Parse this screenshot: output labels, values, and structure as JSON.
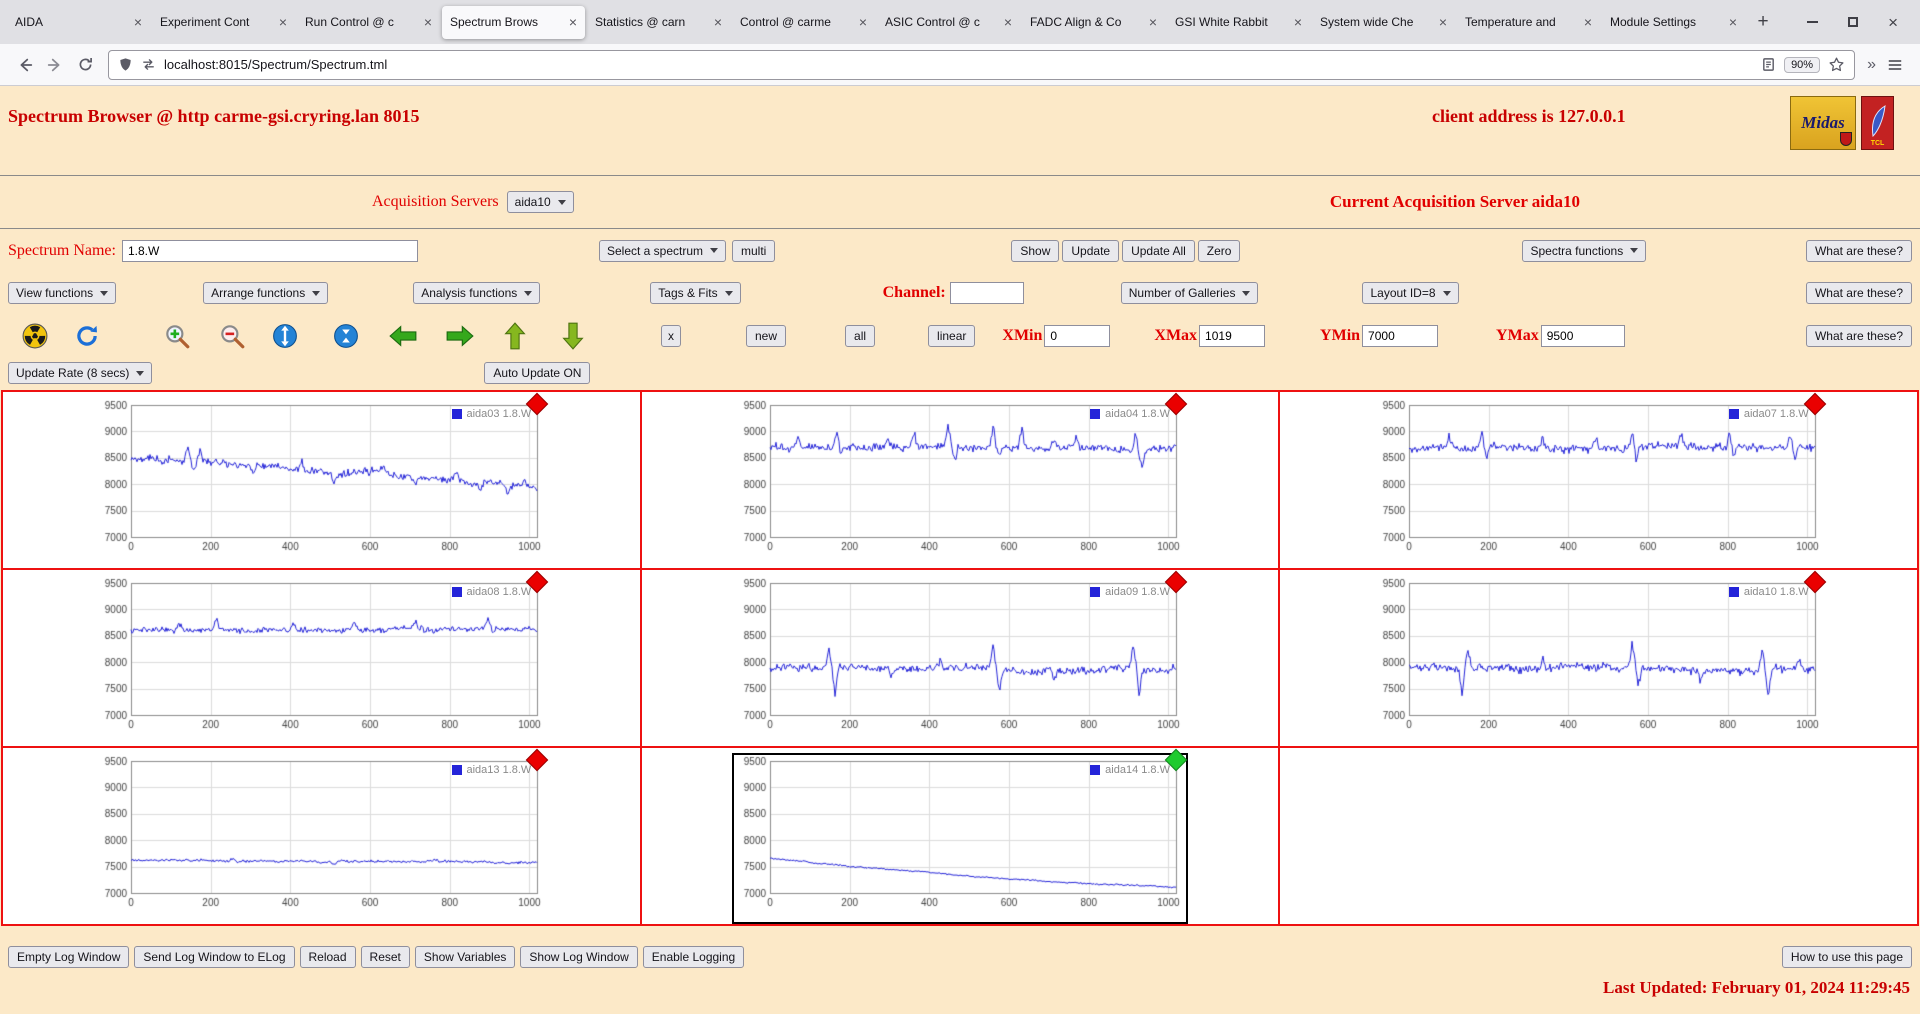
{
  "browser": {
    "tabs": [
      "AIDA",
      "Experiment Cont",
      "Run Control @ c",
      "Spectrum Brows",
      "Statistics @ carn",
      "Control @ carme",
      "ASIC Control @ c",
      "FADC Align & Co",
      "GSI White Rabbit",
      "System wide Che",
      "Temperature and",
      "Module Settings"
    ],
    "active_tab_index": 3,
    "tab_close_glyph": "×",
    "new_tab_label": "+",
    "close_glyph": "×",
    "overflow_glyph": "»",
    "url": "localhost:8015/Spectrum/Spectrum.tml",
    "zoom_level": "90%"
  },
  "header": {
    "title": "Spectrum Browser @ http carme-gsi.cryring.lan 8015",
    "client": "client address is 127.0.0.1",
    "midas_logo_text": "Midas",
    "tcl_logo_text": "TCL"
  },
  "acquisition": {
    "label": "Acquisition Servers",
    "selected": "aida10",
    "current": "Current Acquisition Server aida10"
  },
  "controls": {
    "spectrum_name_label": "Spectrum Name:",
    "spectrum_name_value": "1.8.W",
    "select_spectrum": "Select a spectrum",
    "multi": "multi",
    "show": "Show",
    "update": "Update",
    "update_all": "Update All",
    "zero": "Zero",
    "spectra_functions": "Spectra functions",
    "what_are_these": "What are these?",
    "view_functions": "View functions",
    "arrange_functions": "Arrange functions",
    "analysis_functions": "Analysis functions",
    "tags_fits": "Tags & Fits",
    "channel_label": "Channel:",
    "channel_value": "",
    "number_of_galleries": "Number of Galleries",
    "layout_id": "Layout ID=8",
    "x_button": "x",
    "new_button": "new",
    "all_button": "all",
    "linear_button": "linear",
    "xmin_label": "XMin",
    "xmin": "0",
    "xmax_label": "XMax",
    "xmax": "1019",
    "ymin_label": "YMin",
    "ymin": "7000",
    "ymax_label": "YMax",
    "ymax": "9500",
    "update_rate": "Update Rate (8 secs)",
    "auto_update": "Auto Update ON"
  },
  "icons": {
    "radiation-icon": "black trefoil on yellow disc",
    "update-refresh-icon": "blue circular arrow",
    "zoom-in-icon": "magnifier with green plus",
    "zoom-out-icon": "magnifier with red minus",
    "y-expand-icon": "blue disc, white vertical arrows outward",
    "y-compress-icon": "blue disc, white vertical arrows inward",
    "pan-left-icon": "green block arrow left",
    "pan-right-icon": "green block arrow right",
    "pan-up-icon": "green block arrow up",
    "pan-down-icon": "green block arrow down"
  },
  "chart_data": [
    {
      "type": "line",
      "title": "aida03 1.8.W",
      "xlabel": "",
      "ylabel": "",
      "xlim": [
        0,
        1019
      ],
      "ylim": [
        7000,
        9500
      ],
      "xticks": [
        0,
        200,
        400,
        600,
        800,
        1000
      ],
      "yticks": [
        7000,
        7500,
        8000,
        8500,
        9000,
        9500
      ],
      "grid": true,
      "legend_position": "top-right",
      "line_color": "#2424d9",
      "marker": "red-diamond",
      "marker_color": "#ea0000",
      "selected": false,
      "seed": 3,
      "baseline_start": 8480,
      "baseline_end": 7920,
      "curve": 50,
      "noise": 110,
      "spikes": [
        [
          0.14,
          300
        ],
        [
          0.155,
          -220
        ],
        [
          0.17,
          260
        ],
        [
          0.3,
          -170
        ],
        [
          0.42,
          190
        ],
        [
          0.5,
          -160
        ],
        [
          0.62,
          170
        ],
        [
          0.7,
          -150
        ],
        [
          0.8,
          170
        ],
        [
          0.86,
          -210
        ],
        [
          0.93,
          -190
        ],
        [
          0.97,
          140
        ]
      ]
    },
    {
      "type": "line",
      "title": "aida04 1.8.W",
      "xlabel": "",
      "ylabel": "",
      "xlim": [
        0,
        1019
      ],
      "ylim": [
        7000,
        9500
      ],
      "xticks": [
        0,
        200,
        400,
        600,
        800,
        1000
      ],
      "yticks": [
        7000,
        7500,
        8000,
        8500,
        9000,
        9500
      ],
      "grid": true,
      "legend_position": "top-right",
      "line_color": "#2424d9",
      "marker": "red-diamond",
      "marker_color": "#ea0000",
      "selected": false,
      "seed": 4,
      "baseline_start": 8700,
      "baseline_end": 8680,
      "curve": 0,
      "noise": 115,
      "spikes": [
        [
          0.07,
          240
        ],
        [
          0.165,
          340
        ],
        [
          0.175,
          -210
        ],
        [
          0.29,
          210
        ],
        [
          0.355,
          290
        ],
        [
          0.44,
          430
        ],
        [
          0.455,
          -280
        ],
        [
          0.55,
          470
        ],
        [
          0.565,
          -230
        ],
        [
          0.62,
          410
        ],
        [
          0.7,
          230
        ],
        [
          0.755,
          270
        ],
        [
          0.9,
          450
        ],
        [
          0.915,
          -370
        ]
      ]
    },
    {
      "type": "line",
      "title": "aida07 1.8.W",
      "xlabel": "",
      "ylabel": "",
      "xlim": [
        0,
        1019
      ],
      "ylim": [
        7000,
        9500
      ],
      "xticks": [
        0,
        200,
        400,
        600,
        800,
        1000
      ],
      "yticks": [
        7000,
        7500,
        8000,
        8500,
        9000,
        9500
      ],
      "grid": true,
      "legend_position": "top-right",
      "line_color": "#2424d9",
      "marker": "red-diamond",
      "marker_color": "#ea0000",
      "selected": false,
      "seed": 7,
      "baseline_start": 8680,
      "baseline_end": 8700,
      "curve": 0,
      "noise": 115,
      "spikes": [
        [
          0.1,
          250
        ],
        [
          0.18,
          350
        ],
        [
          0.19,
          -250
        ],
        [
          0.33,
          230
        ],
        [
          0.46,
          290
        ],
        [
          0.55,
          340
        ],
        [
          0.56,
          -210
        ],
        [
          0.67,
          270
        ],
        [
          0.79,
          330
        ],
        [
          0.8,
          -230
        ],
        [
          0.94,
          370
        ],
        [
          0.95,
          -250
        ]
      ]
    },
    {
      "type": "line",
      "title": "aida08 1.8.W",
      "xlabel": "",
      "ylabel": "",
      "xlim": [
        0,
        1019
      ],
      "ylim": [
        7000,
        9500
      ],
      "xticks": [
        0,
        200,
        400,
        600,
        800,
        1000
      ],
      "yticks": [
        7000,
        7500,
        8000,
        8500,
        9000,
        9500
      ],
      "grid": true,
      "legend_position": "top-right",
      "line_color": "#2424d9",
      "marker": "red-diamond",
      "marker_color": "#ea0000",
      "selected": false,
      "seed": 8,
      "baseline_start": 8600,
      "baseline_end": 8620,
      "curve": 0,
      "noise": 85,
      "spikes": [
        [
          0.12,
          170
        ],
        [
          0.21,
          230
        ],
        [
          0.4,
          160
        ],
        [
          0.55,
          190
        ],
        [
          0.7,
          170
        ],
        [
          0.88,
          210
        ],
        [
          0.89,
          -150
        ]
      ]
    },
    {
      "type": "line",
      "title": "aida09 1.8.W",
      "xlabel": "",
      "ylabel": "",
      "xlim": [
        0,
        1019
      ],
      "ylim": [
        7000,
        9500
      ],
      "xticks": [
        0,
        200,
        400,
        600,
        800,
        1000
      ],
      "yticks": [
        7000,
        7500,
        8000,
        8500,
        9000,
        9500
      ],
      "grid": true,
      "legend_position": "top-right",
      "line_color": "#2424d9",
      "marker": "red-diamond",
      "marker_color": "#ea0000",
      "selected": false,
      "seed": 9,
      "baseline_start": 7890,
      "baseline_end": 7880,
      "curve": 0,
      "noise": 120,
      "spikes": [
        [
          0.145,
          430
        ],
        [
          0.16,
          -530
        ],
        [
          0.3,
          -190
        ],
        [
          0.42,
          210
        ],
        [
          0.55,
          490
        ],
        [
          0.565,
          -430
        ],
        [
          0.7,
          -210
        ],
        [
          0.895,
          530
        ],
        [
          0.91,
          -490
        ]
      ]
    },
    {
      "type": "line",
      "title": "aida10 1.8.W",
      "xlabel": "",
      "ylabel": "",
      "xlim": [
        0,
        1019
      ],
      "ylim": [
        7000,
        9500
      ],
      "xticks": [
        0,
        200,
        400,
        600,
        800,
        1000
      ],
      "yticks": [
        7000,
        7500,
        8000,
        8500,
        9000,
        9500
      ],
      "grid": true,
      "legend_position": "top-right",
      "line_color": "#2424d9",
      "marker": "red-diamond",
      "marker_color": "#ea0000",
      "selected": false,
      "seed": 10,
      "baseline_start": 7900,
      "baseline_end": 7890,
      "curve": 0,
      "noise": 120,
      "spikes": [
        [
          0.13,
          -470
        ],
        [
          0.145,
          390
        ],
        [
          0.33,
          230
        ],
        [
          0.55,
          510
        ],
        [
          0.565,
          -390
        ],
        [
          0.72,
          -230
        ],
        [
          0.87,
          490
        ],
        [
          0.885,
          -530
        ],
        [
          0.96,
          210
        ]
      ]
    },
    {
      "type": "line",
      "title": "aida13 1.8.W",
      "xlabel": "",
      "ylabel": "",
      "xlim": [
        0,
        1019
      ],
      "ylim": [
        7000,
        9500
      ],
      "xticks": [
        0,
        200,
        400,
        600,
        800,
        1000
      ],
      "yticks": [
        7000,
        7500,
        8000,
        8500,
        9000,
        9500
      ],
      "grid": true,
      "legend_position": "top-right",
      "line_color": "#2424d9",
      "marker": "red-diamond",
      "marker_color": "#ea0000",
      "selected": false,
      "seed": 13,
      "baseline_start": 7610,
      "baseline_end": 7590,
      "curve": 0,
      "noise": 40,
      "spikes": [
        [
          0.25,
          80
        ],
        [
          0.5,
          -70
        ],
        [
          0.75,
          70
        ]
      ]
    },
    {
      "type": "line",
      "title": "aida14 1.8.W",
      "xlabel": "",
      "ylabel": "",
      "xlim": [
        0,
        1019
      ],
      "ylim": [
        7000,
        9500
      ],
      "xticks": [
        0,
        200,
        400,
        600,
        800,
        1000
      ],
      "yticks": [
        7000,
        7500,
        8000,
        8500,
        9000,
        9500
      ],
      "grid": true,
      "legend_position": "top-right",
      "line_color": "#2424d9",
      "marker": "green-diamond",
      "marker_color": "#1ecb2e",
      "selected": true,
      "seed": 14,
      "baseline_start": 7660,
      "baseline_end": 7110,
      "curve": -70,
      "noise": 25,
      "spikes": []
    }
  ],
  "footer": {
    "buttons": [
      "Empty Log Window",
      "Send Log Window to ELog",
      "Reload",
      "Reset",
      "Show Variables",
      "Show Log Window",
      "Enable Logging"
    ],
    "help": "How to use this page",
    "last_updated": "Last Updated: February 01, 2024 11:29:45"
  }
}
